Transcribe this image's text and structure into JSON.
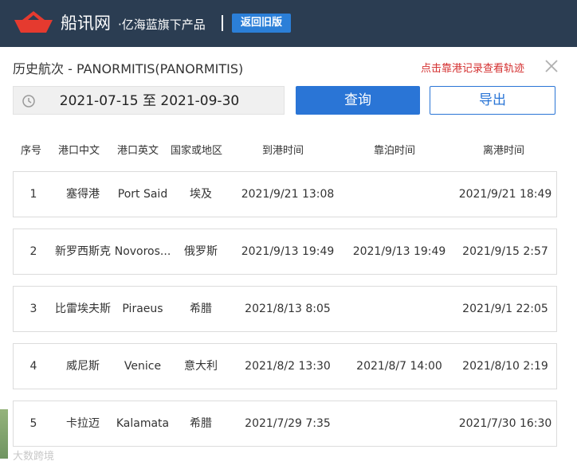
{
  "header": {
    "logo_text": "船讯网",
    "logo_sub": "·亿海蓝旗下产品",
    "back_label": "返回旧版"
  },
  "panel": {
    "title": "历史航次 - PANORMITIS(PANORMITIS)",
    "track_link": "点击靠港记录查看轨迹",
    "date_range": "2021-07-15 至 2021-09-30",
    "query_label": "查询",
    "export_label": "导出"
  },
  "table": {
    "headers": [
      "序号",
      "港口中文",
      "港口英文",
      "国家或地区",
      "到港时间",
      "靠泊时间",
      "离港时间"
    ],
    "rows": [
      {
        "no": "1",
        "port_cn": "塞得港",
        "port_en": "Port Said",
        "country": "埃及",
        "arrival": "2021/9/21 13:08",
        "berth": "",
        "depart": "2021/9/21 18:49"
      },
      {
        "no": "2",
        "port_cn": "新罗西斯克",
        "port_en": "Novoros...",
        "country": "俄罗斯",
        "arrival": "2021/9/13 19:49",
        "berth": "2021/9/13 19:49",
        "depart": "2021/9/15 2:57"
      },
      {
        "no": "3",
        "port_cn": "比雷埃夫斯",
        "port_en": "Piraeus",
        "country": "希腊",
        "arrival": "2021/8/13 8:05",
        "berth": "",
        "depart": "2021/9/1 22:05"
      },
      {
        "no": "4",
        "port_cn": "威尼斯",
        "port_en": "Venice",
        "country": "意大利",
        "arrival": "2021/8/2 13:30",
        "berth": "2021/8/7 14:00",
        "depart": "2021/8/10 2:19"
      },
      {
        "no": "5",
        "port_cn": "卡拉迈",
        "port_en": "Kalamata",
        "country": "希腊",
        "arrival": "2021/7/29 7:35",
        "berth": "",
        "depart": "2021/7/30 16:30"
      }
    ]
  },
  "watermark": "大数跨境",
  "colors": {
    "header_bg": "#2b3d52",
    "accent": "#2a75d6",
    "link_red": "#d43030"
  }
}
